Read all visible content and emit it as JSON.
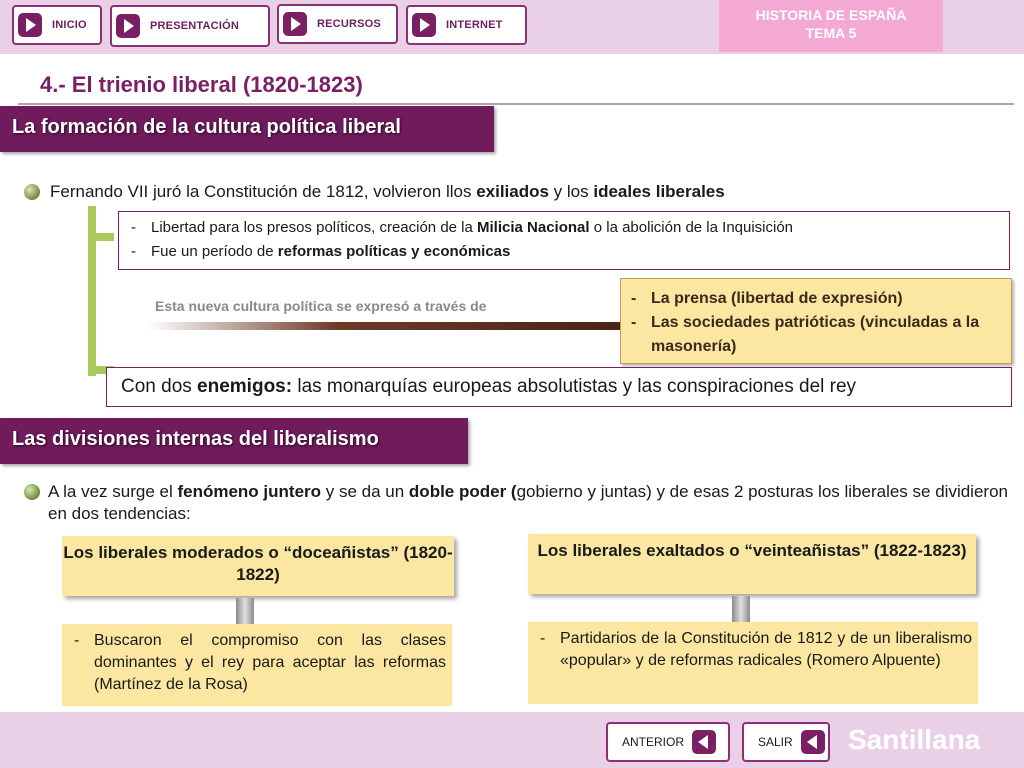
{
  "nav": {
    "items": [
      {
        "label": "INICIO"
      },
      {
        "label": "PRESENTACIÓN"
      },
      {
        "label": "RECURSOS"
      },
      {
        "label": "INTERNET"
      }
    ],
    "brand_line1": "HISTORIA DE ESPAÑA",
    "brand_line2": "TEMA 5"
  },
  "title": "4.- El trienio liberal (1820-1823)",
  "section1": {
    "heading": "La formación de la cultura política liberal",
    "bullet": {
      "t1": "Fernando VII juró la Constitución de 1812, volvieron llos ",
      "b1": "exiliados",
      "t2": " y los ",
      "b2": "ideales liberales"
    },
    "list": {
      "item1": {
        "dash": "-",
        "t1": "Libertad para los presos políticos, creación de la ",
        "b1": "Milicia Nacional",
        "t2": " o la abolición de la Inquisición"
      },
      "item2": {
        "dash": "-",
        "t1": "Fue un período de ",
        "b1": "reformas políticas y económicas"
      }
    },
    "culture_text": "Esta nueva cultura política se expresó a través de",
    "channels": [
      {
        "dash": "-",
        "text": "La prensa (libertad de expresión)"
      },
      {
        "dash": "-",
        "text": "Las sociedades patrióticas (vinculadas a la masonería)"
      }
    ],
    "enemies": {
      "t1": "Con dos ",
      "b1": "enemigos:",
      "t2": " las monarquías europeas absolutistas y las conspiraciones del rey"
    }
  },
  "section2": {
    "heading": "Las divisiones internas del liberalismo",
    "bullet": {
      "t1": "A la vez surge el ",
      "b1": "fenómeno juntero",
      "t2": " y se da un ",
      "b2": "doble poder (",
      "t3": "gobierno y juntas) y de esas 2 posturas los liberales se dividieron en dos tendencias:"
    },
    "moderados": {
      "title": "Los liberales moderados o “doceañistas” (1820-1822)",
      "dash": "-",
      "detail": "Buscaron el compromiso con las clases dominantes y el rey para aceptar las reformas (Martínez de la Rosa)"
    },
    "exaltados": {
      "title": "Los liberales exaltados o “veinteañistas” (1822-1823)",
      "dash": "-",
      "detail": "Partidarios de la Constitución de 1812 y de un liberalismo «popular» y de reformas radicales (Romero Alpuente)"
    }
  },
  "footer": {
    "back_label": "ANTERIOR",
    "exit_label": "SALIR",
    "publisher": "Santillana"
  },
  "colors": {
    "accent": "#7a1f64",
    "nav_background": "#ead0e6",
    "brand_background": "#f4a9d3",
    "highlight_box": "#fbe7a2",
    "bracket": "#a9c95a"
  },
  "icons": [
    "play-arrow-icon",
    "back-arrow-icon",
    "bullet-icon"
  ]
}
